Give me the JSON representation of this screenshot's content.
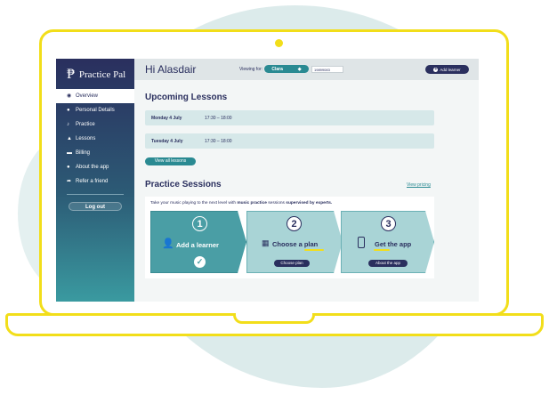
{
  "app": {
    "name": "Practice Pal"
  },
  "sidebar": {
    "items": [
      {
        "label": "Overview",
        "icon": "eye-icon",
        "active": true
      },
      {
        "label": "Personal Details",
        "icon": "person-icon"
      },
      {
        "label": "Practice",
        "icon": "music-note-icon"
      },
      {
        "label": "Lessons",
        "icon": "graduation-cap-icon"
      },
      {
        "label": "Billing",
        "icon": "card-icon"
      },
      {
        "label": "About the app",
        "icon": "info-icon"
      },
      {
        "label": "Refer a friend",
        "icon": "share-icon"
      }
    ],
    "logout_label": "Log out"
  },
  "header": {
    "greeting": "Hi Alasdair",
    "viewing_label": "Viewing for:",
    "learner": "Clara",
    "phone": "19899083",
    "add_learner_label": "Add learner"
  },
  "lessons": {
    "title": "Upcoming Lessons",
    "rows": [
      {
        "day": "Monday 4 July",
        "time": "17:30 – 18:00"
      },
      {
        "day": "Tuesday 4 July",
        "time": "17:30 – 18:00"
      }
    ],
    "view_all_label": "View all lessons"
  },
  "practice": {
    "title": "Practice Sessions",
    "view_pricing_label": "View pricing",
    "tagline_pre": "Take your music playing to the next level with ",
    "tagline_bold1": "music practice",
    "tagline_mid": " sessions ",
    "tagline_bold2": "supervised by experts.",
    "steps": [
      {
        "num": "1",
        "label": "Add a learner",
        "icon": "add-user-icon"
      },
      {
        "num": "2",
        "label": "Choose a plan",
        "icon": "calendar-icon",
        "button": "Choose plan"
      },
      {
        "num": "3",
        "label": "Get the app",
        "icon": "phone-icon",
        "button": "About the app"
      }
    ]
  },
  "colors": {
    "accent": "#2a8a92",
    "navy": "#2a2f5e",
    "highlight": "#f2de1a"
  }
}
